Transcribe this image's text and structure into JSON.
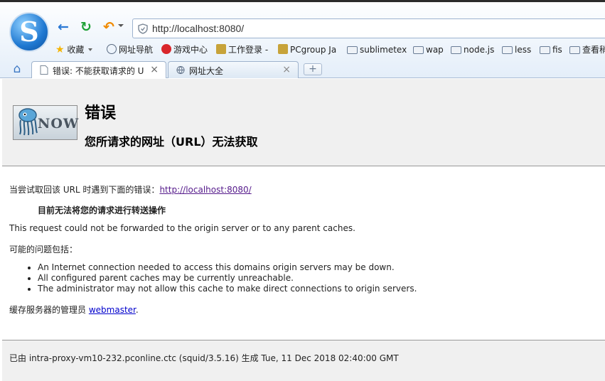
{
  "browser": {
    "url": "http://localhost:8080/",
    "bookmarks": [
      {
        "label": "收藏",
        "icon": "star-icon"
      },
      {
        "label": "网址导航",
        "icon": "globe-icon"
      },
      {
        "label": "游戏中心",
        "icon": "game-icon"
      },
      {
        "label": "工作登录 -",
        "icon": "sohu-icon"
      },
      {
        "label": "PCgroup Ja",
        "icon": "sohu-icon"
      },
      {
        "label": "sublimetex",
        "icon": "folder-icon"
      },
      {
        "label": "wap",
        "icon": "folder-icon"
      },
      {
        "label": "node.js",
        "icon": "folder-icon"
      },
      {
        "label": "less",
        "icon": "folder-icon"
      },
      {
        "label": "fis",
        "icon": "folder-icon"
      },
      {
        "label": "查看稍",
        "icon": "folder-icon"
      }
    ],
    "tabs": [
      {
        "title": "错误: 不能获取请求的 U",
        "close": "×"
      },
      {
        "title": "网址大全",
        "close": "×"
      }
    ],
    "new_tab": "+"
  },
  "error_page": {
    "title": "错误",
    "subtitle": "您所请求的网址（URL）无法获取",
    "logo_text": "NOW",
    "attempt_prefix": "当尝试取回该 URL 时遇到下面的错误：",
    "attempt_url": "http://localhost:8080/",
    "reason": "目前无法将您的请求进行转送操作",
    "explanation": "This request could not be forwarded to the origin server or to any parent caches.",
    "causes_heading": "可能的问题包括：",
    "causes": [
      "An Internet connection needed to access this domains origin servers may be down.",
      "All configured parent caches may be currently unreachable.",
      "The administrator may not allow this cache to make direct connections to origin servers."
    ],
    "admin_prefix": "缓存服务器的管理员",
    "admin_link": "webmaster",
    "admin_suffix": ".",
    "footer": "已由 intra-proxy-vm10-232.pconline.ctc (squid/3.5.16) 生成 Tue, 11 Dec 2018 02:40:00 GMT"
  }
}
